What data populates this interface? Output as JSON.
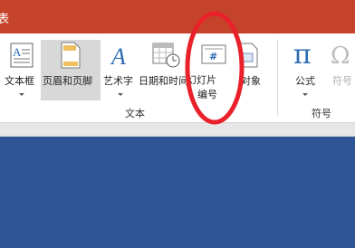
{
  "window": {
    "title_fragment": "表"
  },
  "ribbon": {
    "buttons": [
      {
        "label": "文本框",
        "icon": "textbox-icon",
        "has_dropdown": true
      },
      {
        "label": "页眉和页脚",
        "icon": "header-footer-icon",
        "selected": true
      },
      {
        "label": "艺术字",
        "icon": "wordart-icon",
        "has_dropdown": true
      },
      {
        "label": "日期和时间",
        "icon": "calendar-icon"
      },
      {
        "label_line1": "幻灯片",
        "label_line2": "编号",
        "icon": "slide-number-icon",
        "glyph": "#"
      },
      {
        "label": "对象",
        "icon": "object-icon"
      },
      {
        "label": "公式",
        "icon": "pi-icon",
        "glyph": "π",
        "has_dropdown": true
      },
      {
        "label": "符号",
        "icon": "omega-icon",
        "glyph": "Ω",
        "disabled": true
      }
    ],
    "groups": [
      {
        "label": "文本"
      },
      {
        "label": "符号"
      }
    ]
  },
  "colors": {
    "titlebar": "#c6432b",
    "slide_background": "#2e5597",
    "icon_blue": "#2f6db5",
    "annotation_red": "#e8212a"
  }
}
